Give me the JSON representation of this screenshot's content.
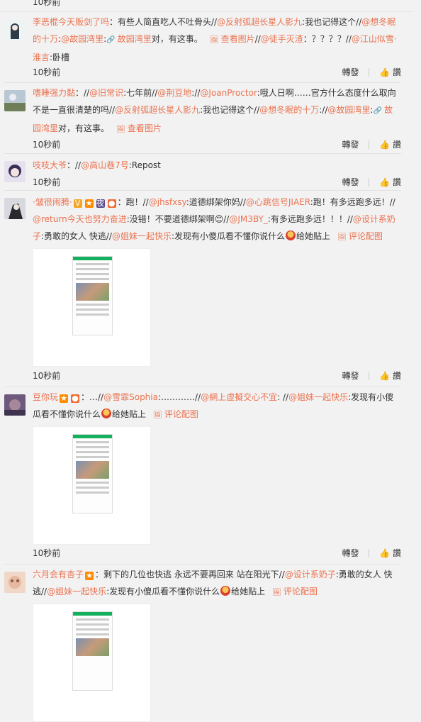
{
  "topcut": {
    "time": "10秒前",
    "repost": "轉發",
    "like": "讚"
  },
  "items": [
    {
      "user": "李恶棍今天贩剑了吗",
      "segments": [
        {
          "t": "：有些人简直吃人不吐骨头//"
        },
        {
          "t": "@反射弧超长星人影九",
          "u": true
        },
        {
          "t": ":我也记得这个//"
        },
        {
          "t": "@想冬眠的十万",
          "u": true
        },
        {
          "t": ":"
        },
        {
          "t": "@故园湾里",
          "u": true
        },
        {
          "t": ":"
        },
        {
          "t": "故园湾里",
          "u": true,
          "icon": "link"
        },
        {
          "t": "对，有这事。"
        },
        {
          "t": "查看图片",
          "u": true,
          "icon": "pic"
        },
        {
          "t": "//"
        },
        {
          "t": "@徒手灭渣",
          "u": true
        },
        {
          "t": "：？？？？//"
        },
        {
          "t": "@江山似雪·淮言",
          "u": true
        },
        {
          "t": ":卧槽"
        }
      ],
      "time": "10秒前",
      "repost": "轉發",
      "like": "讚"
    },
    {
      "user": "嗜睡强力黏",
      "segments": [
        {
          "t": "：//"
        },
        {
          "t": "@旧常识",
          "u": true
        },
        {
          "t": ":七年前//"
        },
        {
          "t": "@荆豆地",
          "u": true
        },
        {
          "t": "://"
        },
        {
          "t": "@JoanProctor",
          "u": true
        },
        {
          "t": ":哦人日啊……官方什么态度什么取向不是一直很清楚的吗//"
        },
        {
          "t": "@反射弧超长星人影九",
          "u": true
        },
        {
          "t": ":我也记得这个//"
        },
        {
          "t": "@想冬眠的十万",
          "u": true
        },
        {
          "t": "://"
        },
        {
          "t": "@故园湾里",
          "u": true
        },
        {
          "t": ":"
        },
        {
          "t": "故园湾里",
          "u": true,
          "icon": "link"
        },
        {
          "t": "对，有这事。"
        },
        {
          "t": "查看图片",
          "u": true,
          "icon": "pic"
        }
      ],
      "time": "10秒前",
      "repost": "轉發",
      "like": "讚"
    },
    {
      "user": "吱吱大爷",
      "segments": [
        {
          "t": "：//"
        },
        {
          "t": "@高山巷7号",
          "u": true
        },
        {
          "t": ":Repost"
        }
      ],
      "time": "10秒前",
      "repost": "轉發",
      "like": "讚"
    },
    {
      "user": "·皱很闹腾·",
      "badges": true,
      "segments": [
        {
          "t": "：跑！//"
        },
        {
          "t": "@jhsfxsy",
          "u": true
        },
        {
          "t": ":道德绑架你妈//"
        },
        {
          "t": "@心跳信号JIAER",
          "u": true
        },
        {
          "t": ":跑！有多远跑多远！//"
        },
        {
          "t": "@return今天也努力奋进",
          "u": true
        },
        {
          "t": ":没错！不要道德绑架啊😊//"
        },
        {
          "t": "@JM3BY_",
          "u": true
        },
        {
          "t": ":有多远跑多远！！！//"
        },
        {
          "t": "@设计系奶子",
          "u": true
        },
        {
          "t": ":勇敢的女人 快逃//"
        },
        {
          "t": "@姐妹一起快乐",
          "u": true
        },
        {
          "t": ":发现有小傻瓜看不懂你说什么"
        },
        {
          "t": "",
          "emoji": true
        },
        {
          "t": "给她贴上"
        },
        {
          "t": "评论配图",
          "u": true,
          "icon": "pic"
        }
      ],
      "time": "10秒前",
      "repost": "轉發",
      "like": "讚"
    },
    {
      "user": "豆你玩",
      "badges2": true,
      "segments": [
        {
          "t": "：…//"
        },
        {
          "t": "@雪霏Sophia",
          "u": true
        },
        {
          "t": ":…………//"
        },
        {
          "t": "@網上虛擬交心不宜",
          "u": true
        },
        {
          "t": ": //"
        },
        {
          "t": "@姐妹一起快乐",
          "u": true
        },
        {
          "t": ":发现有小傻瓜看不懂你说什么"
        },
        {
          "t": "",
          "emoji": true
        },
        {
          "t": "给她贴上"
        },
        {
          "t": "评论配图",
          "u": true,
          "icon": "pic"
        }
      ],
      "time": "10秒前",
      "repost": "轉發",
      "like": "讚"
    },
    {
      "user": "六月会有杏子",
      "badges3": true,
      "segments": [
        {
          "t": "：剩下的几位也快逃 永远不要再回来 站在阳光下//"
        },
        {
          "t": "@设计系奶子",
          "u": true
        },
        {
          "t": ":勇敢的女人 快逃//"
        },
        {
          "t": "@姐妹一起快乐",
          "u": true
        },
        {
          "t": ":发现有小傻瓜看不懂你说什么"
        },
        {
          "t": "",
          "emoji": true
        },
        {
          "t": "给她贴上"
        },
        {
          "t": "评论配图",
          "u": true,
          "icon": "pic"
        }
      ]
    }
  ]
}
